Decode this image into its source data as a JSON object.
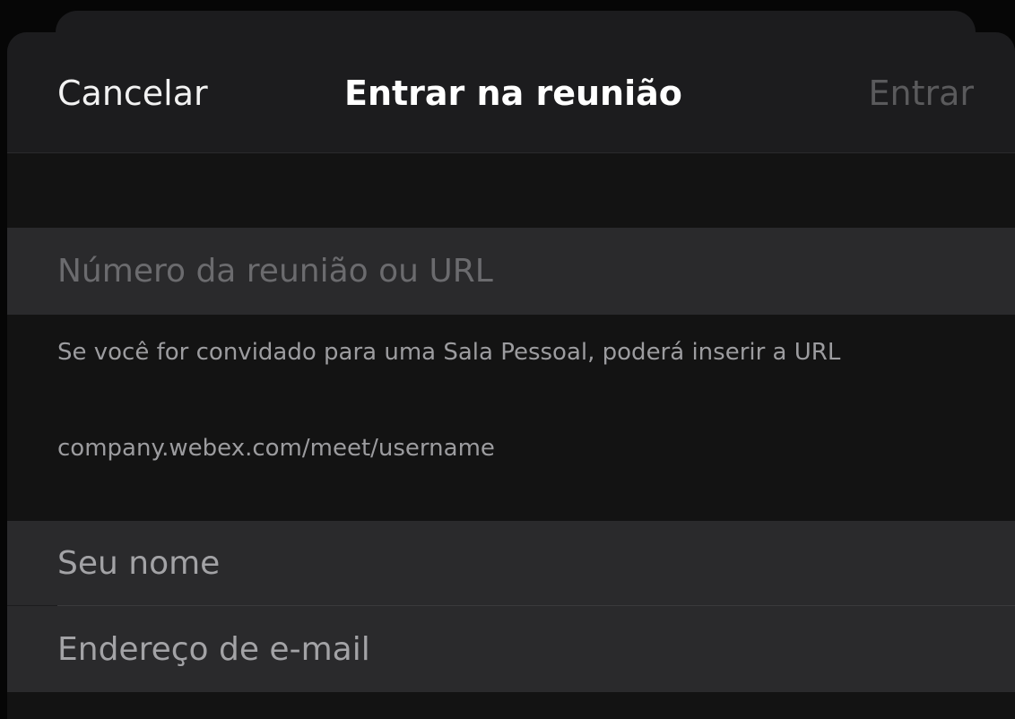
{
  "navbar": {
    "cancel_label": "Cancelar",
    "title": "Entrar na reunião",
    "join_label": "Entrar"
  },
  "meeting_field": {
    "placeholder": "Número da reunião ou URL",
    "value": ""
  },
  "helper": {
    "text": "Se você for convidado para uma Sala Pessoal, poderá inserir a URL",
    "example_url": "company.webex.com/meet/username"
  },
  "name_field": {
    "placeholder": "Seu nome",
    "value": ""
  },
  "email_field": {
    "placeholder": "Endereço de e-mail",
    "value": ""
  },
  "colors": {
    "background": "#060606",
    "sheet": "#1c1c1e",
    "field": "#2a2a2c",
    "disabled_text": "#5a5a5c"
  }
}
